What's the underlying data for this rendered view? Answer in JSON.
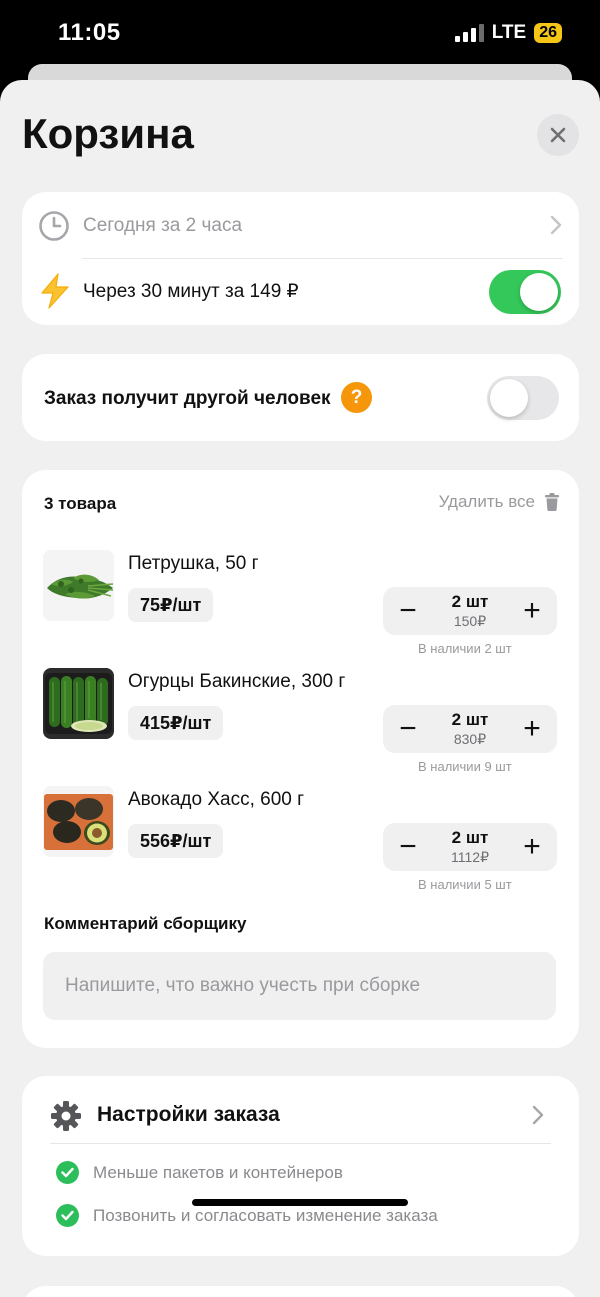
{
  "status_bar": {
    "time": "11:05",
    "network": "LTE",
    "battery": "26"
  },
  "header": {
    "title": "Корзина"
  },
  "delivery": {
    "standard_label": "Сегодня за 2 часа",
    "express_label": "Через 30 минут за 149 ₽",
    "express_enabled": true
  },
  "recipient": {
    "label": "Заказ получит другой человек",
    "help_symbol": "?",
    "enabled": false
  },
  "cart": {
    "count_label": "3 товара",
    "delete_all_label": "Удалить все",
    "items": [
      {
        "name": "Петрушка, 50 г",
        "price": "75₽/шт",
        "qty": "2 шт",
        "sum": "150₽",
        "stock_label": "В наличии",
        "stock_value": "2 шт",
        "image": "parsley"
      },
      {
        "name": "Огурцы Бакинские, 300 г",
        "price": "415₽/шт",
        "qty": "2 шт",
        "sum": "830₽",
        "stock_label": "В наличии",
        "stock_value": "9 шт",
        "image": "cucumbers"
      },
      {
        "name": "Авокадо Хасс, 600 г",
        "price": "556₽/шт",
        "qty": "2 шт",
        "sum": "1112₽",
        "stock_label": "В наличии",
        "stock_value": "5 шт",
        "image": "avocado"
      }
    ],
    "stepper": {
      "minus": "−",
      "plus": "+"
    },
    "comment_title": "Комментарий сборщику",
    "comment_placeholder": "Напишите, что важно учесть при сборке",
    "comment_value": ""
  },
  "settings": {
    "title": "Настройки заказа",
    "options": [
      {
        "label": "Меньше пакетов и контейнеров",
        "checked": true
      },
      {
        "label": "Позвонить и согласовать изменение заказа",
        "checked": true
      }
    ]
  },
  "colors": {
    "accent_green": "#34c759",
    "check_green": "#2dbe5c",
    "help_orange": "#f5960b",
    "bolt_yellow": "#f9c22e"
  },
  "icons": [
    "close-icon",
    "clock-icon",
    "chevron-right-icon",
    "bolt-icon",
    "trash-icon",
    "gear-icon",
    "check-icon"
  ]
}
